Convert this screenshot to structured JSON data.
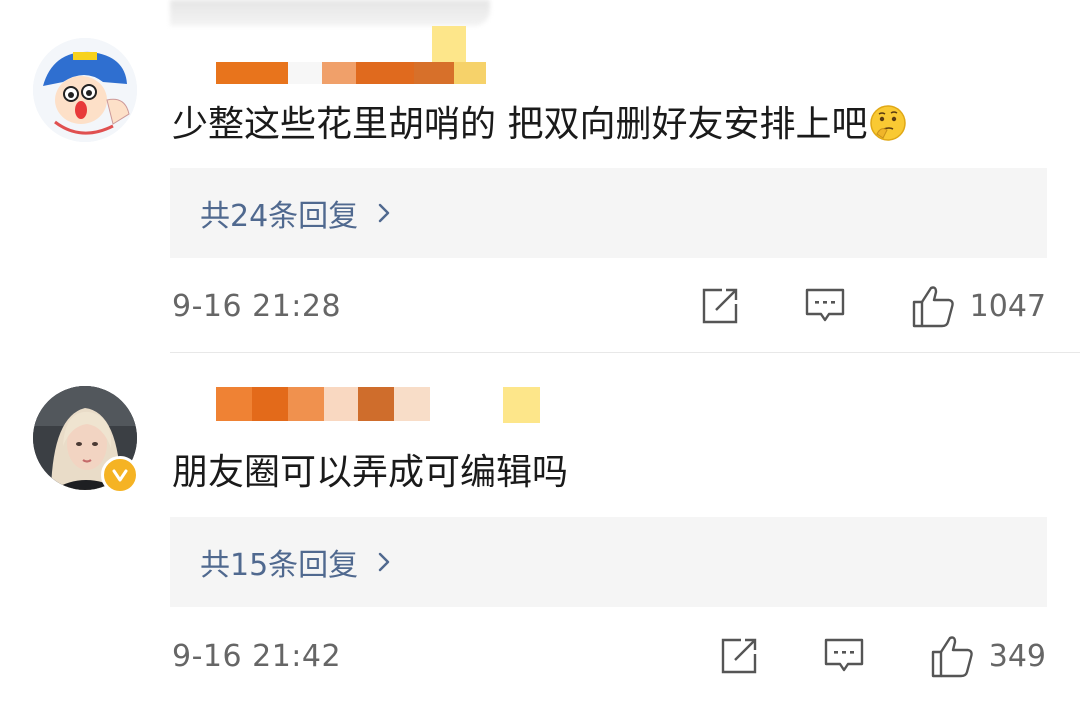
{
  "comments": [
    {
      "text": "少整这些花里胡哨的 把双向删好友安排上吧",
      "emoji": "thinking-face-emoji",
      "reply_label": "共24条回复",
      "timestamp": "9-16 21:28",
      "likes": "1047"
    },
    {
      "text": "朋友圈可以弄成可编辑吗",
      "reply_label": "共15条回复",
      "timestamp": "9-16 21:42",
      "likes": "349",
      "verified": true
    }
  ],
  "colors": {
    "reply_link": "#50698f",
    "meta_gray": "#666666",
    "reply_bg": "#f5f5f5",
    "verified_badge": "#f5b324"
  }
}
